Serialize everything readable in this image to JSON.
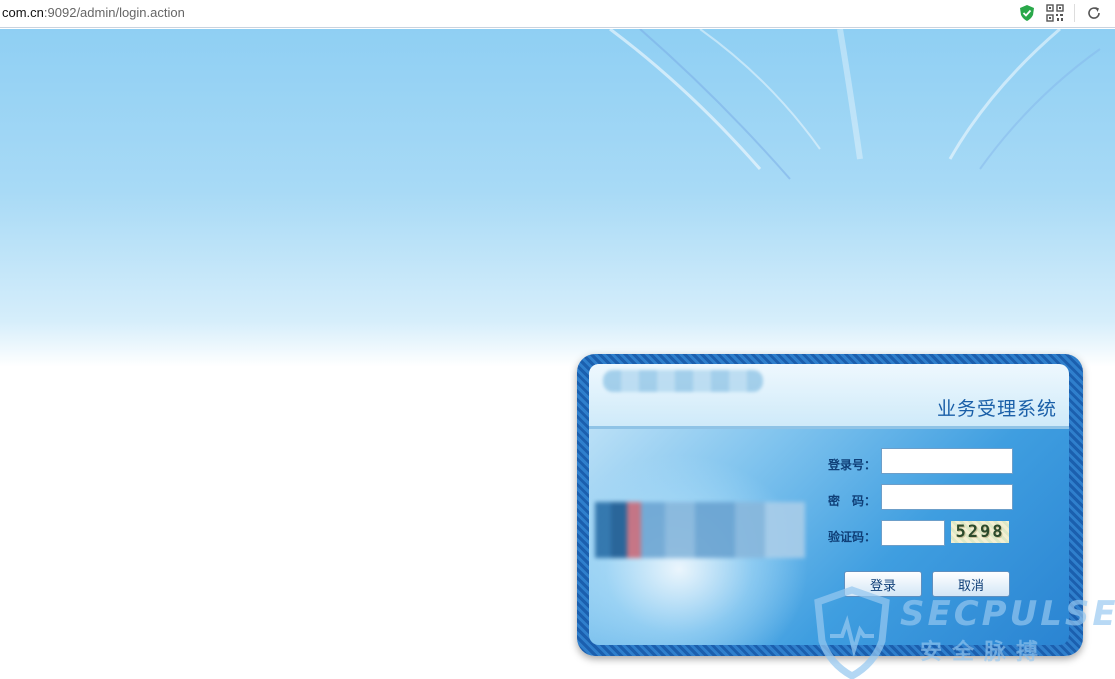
{
  "browser": {
    "url_host": "com.cn",
    "url_path": ":9092/admin/login.action",
    "icons": [
      "shield-check-icon",
      "qr-code-icon",
      "refresh-icon"
    ]
  },
  "panel": {
    "system_title": "业务受理系统",
    "labels": {
      "username": "登录号：",
      "password": "密　码：",
      "captcha": "验证码："
    },
    "inputs": {
      "username_value": "",
      "password_value": "",
      "captcha_value": ""
    },
    "captcha_image_text": "5298",
    "buttons": {
      "login": "登录",
      "cancel": "取消"
    }
  },
  "watermark": {
    "text": "SECPULSE",
    "subtext": "安全脉搏"
  },
  "colors": {
    "accent": "#1a5fa8",
    "frame": "#1b5fae",
    "label": "#0f3f78"
  }
}
